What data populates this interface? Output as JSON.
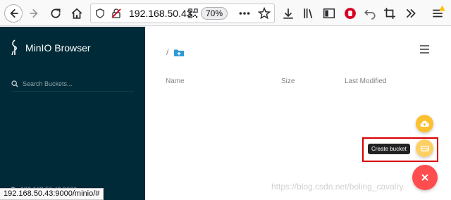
{
  "browser": {
    "url": "192.168.50.43:9000",
    "zoom": "70%",
    "status_url": "192.168.50.43:9000/minio/#"
  },
  "sidebar": {
    "brand": "MinIO Browser",
    "search_placeholder": "Search Buckets...",
    "host": "192.168.50.43:9000"
  },
  "main": {
    "breadcrumb_sep": "/",
    "columns": [
      "Name",
      "Size",
      "Last Modified"
    ]
  },
  "actions": {
    "create_bucket_tooltip": "Create bucket"
  },
  "colors": {
    "sidebar_bg": "#002a37",
    "fab_upload": "#fdc02f",
    "fab_create": "#fecf63",
    "fab_close": "#ff4d4f",
    "highlight_border": "#d80000"
  },
  "watermark": "https://blog.csdn.net/boling_cavalry"
}
